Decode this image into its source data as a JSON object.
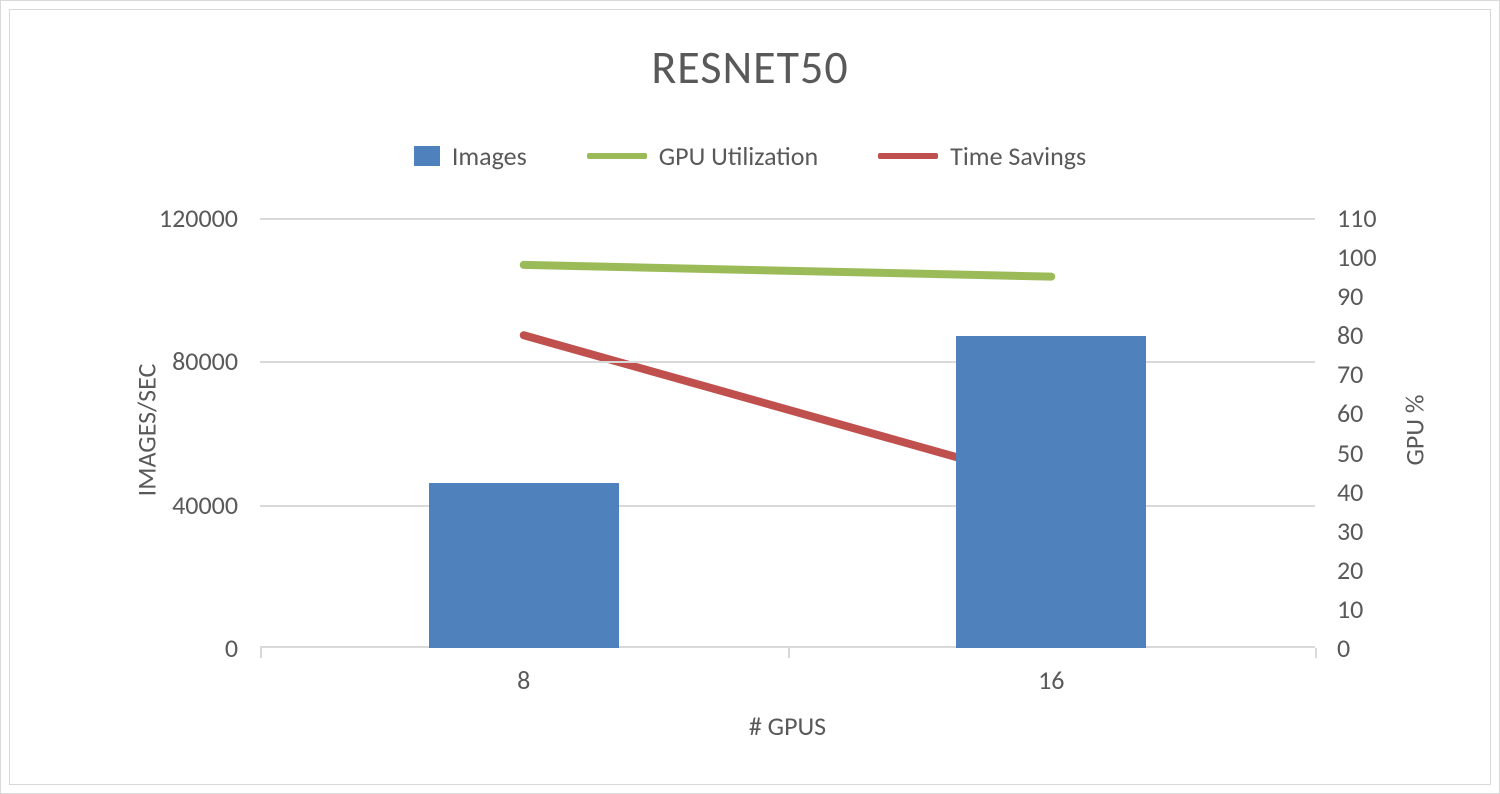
{
  "chart_data": {
    "type": "bar+line",
    "title": "RESNET50",
    "xlabel": "# GPUS",
    "categories": [
      "8",
      "16"
    ],
    "series": [
      {
        "name": "Images",
        "type": "bar",
        "axis": "left",
        "values": [
          46000,
          87000
        ]
      },
      {
        "name": "GPU Utilization",
        "type": "line",
        "axis": "right",
        "values": [
          98,
          95
        ]
      },
      {
        "name": "Time Savings",
        "type": "arrow",
        "axis": "right",
        "values": [
          80,
          42
        ]
      }
    ],
    "left_axis": {
      "label": "IMAGES/SEC",
      "min": 0,
      "max": 120000,
      "ticks": [
        0,
        40000,
        80000,
        120000
      ]
    },
    "right_axis": {
      "label": "GPU %",
      "min": 0,
      "max": 110,
      "ticks": [
        0,
        10,
        20,
        30,
        40,
        50,
        60,
        70,
        80,
        90,
        100,
        110
      ]
    },
    "colors": {
      "Images": "#4f81bd",
      "GPU Utilization": "#9bbb59",
      "Time Savings": "#c0504d",
      "grid": "#d9d9d9",
      "text": "#595959"
    }
  },
  "legend": {
    "images": "Images",
    "gpu": "GPU Utilization",
    "time": "Time Savings"
  }
}
